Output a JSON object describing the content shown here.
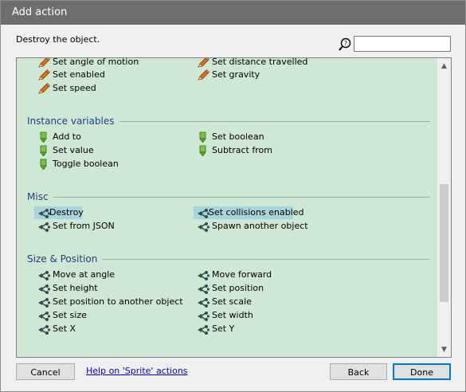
{
  "window": {
    "title": "Add action"
  },
  "description": "Destroy the object.",
  "search": {
    "value": "",
    "placeholder": ""
  },
  "sections": {
    "instance_variables": "Instance variables",
    "misc": "Misc",
    "size_position": "Size & Position"
  },
  "items": {
    "set_angle_of_motion": "Set angle of motion",
    "set_distance_travelled": "Set distance travelled",
    "set_enabled": "Set enabled",
    "set_gravity": "Set gravity",
    "set_speed": "Set speed",
    "add_to": "Add to",
    "set_boolean": "Set boolean",
    "set_value": "Set value",
    "subtract_from": "Subtract from",
    "toggle_boolean": "Toggle boolean",
    "destroy": "Destroy",
    "set_collisions_enabled": "Set collisions enabled",
    "set_from_json": "Set from JSON",
    "spawn_another_object": "Spawn another object",
    "move_at_angle": "Move at angle",
    "move_forward": "Move forward",
    "set_height": "Set height",
    "set_position": "Set position",
    "set_position_to_another_object": "Set position to another object",
    "set_scale": "Set scale",
    "set_size": "Set size",
    "set_width": "Set width",
    "set_x": "Set X",
    "set_y": "Set Y"
  },
  "icons": {
    "behavior": "pencil-icon",
    "variable": "green-marker-icon",
    "object": "sprite-action-icon",
    "search": "search-icon"
  },
  "colors": {
    "title_bar": "#6e6e6e",
    "list_background": "#cfe8d5",
    "selection": "#a9d4dd",
    "section_title": "#1f3d8a",
    "accent": "#0078d7"
  },
  "buttons": {
    "cancel": "Cancel",
    "help": "Help on 'Sprite' actions",
    "back": "Back",
    "done": "Done"
  }
}
